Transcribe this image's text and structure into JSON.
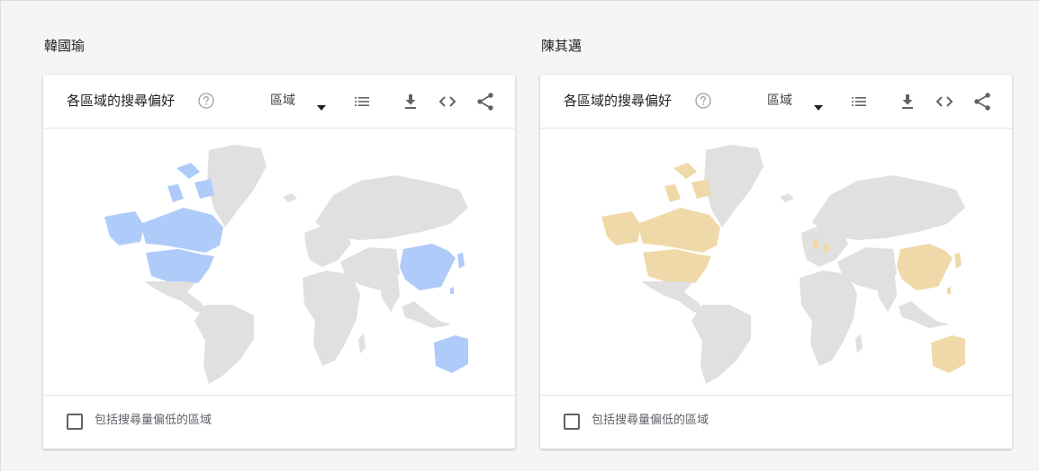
{
  "columns": [
    {
      "term": "韓國瑜",
      "card_title": "各區域的搜尋偏好",
      "region_select": "區域",
      "checkbox_label": "包括搜尋量偏低的區域",
      "highlight_color": "#aecbfa"
    },
    {
      "term": "陳其邁",
      "card_title": "各區域的搜尋偏好",
      "region_select": "區域",
      "checkbox_label": "包括搜尋量偏低的區域",
      "highlight_color": "#f0d9a8"
    }
  ],
  "icons": {
    "help": "help-circle-icon",
    "dropdown": "triangle-down-icon",
    "list": "list-icon",
    "download": "download-icon",
    "embed": "code-icon",
    "share": "share-icon"
  },
  "colors": {
    "map_base": "#e0e0e0",
    "page_background": "#f5f5f5",
    "icon": "#5f6368"
  }
}
